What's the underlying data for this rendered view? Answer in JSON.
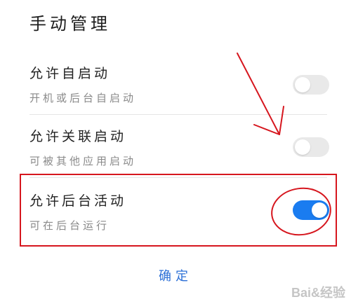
{
  "dialog": {
    "title": "手动管理",
    "items": [
      {
        "label": "允许自启动",
        "subtitle": "开机或后台自启动",
        "toggle_on": false
      },
      {
        "label": "允许关联启动",
        "subtitle": "可被其他应用启动",
        "toggle_on": false
      },
      {
        "label": "允许后台活动",
        "subtitle": "可在后台运行",
        "toggle_on": true
      }
    ],
    "confirm_label": "确定"
  },
  "colors": {
    "toggle_on": "#1a7cf0",
    "toggle_off": "#e9e9e9",
    "annotation": "#d6161e",
    "confirm_text": "#2b6fd6"
  },
  "watermark": "Bai&经验"
}
